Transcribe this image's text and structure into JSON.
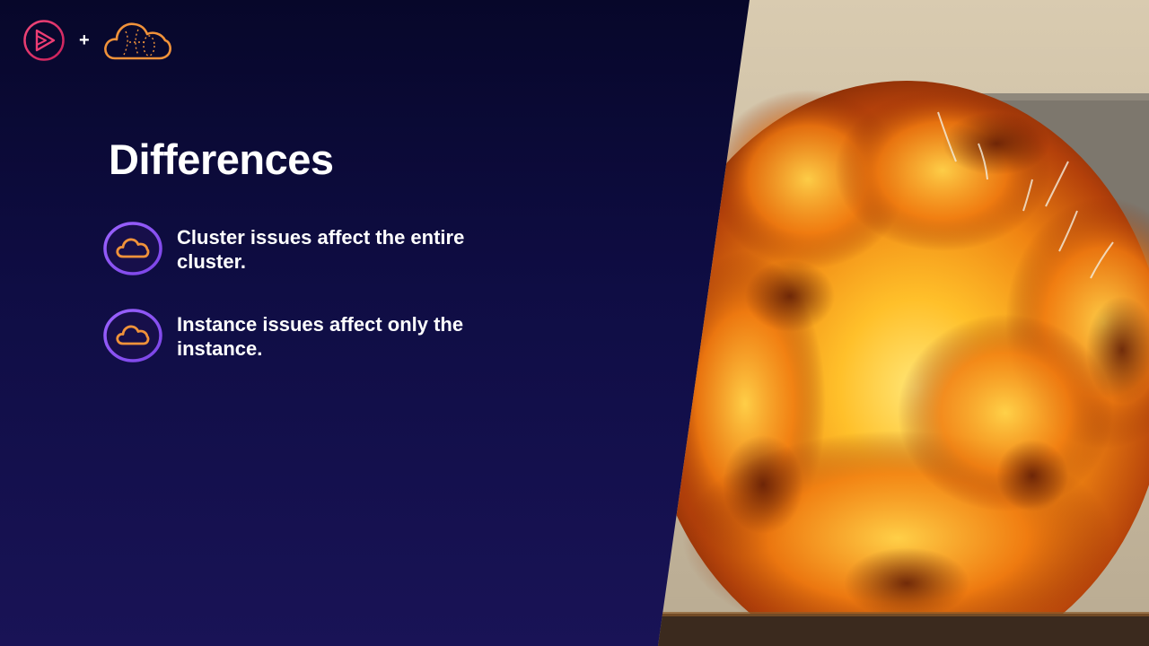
{
  "slide": {
    "title": "Differences",
    "bullets": [
      {
        "text": "Cluster issues affect the entire cluster.",
        "icon": "cloud-icon"
      },
      {
        "text": "Instance issues affect only the instance.",
        "icon": "cloud-icon"
      }
    ]
  },
  "logos": {
    "separator": "+",
    "left_logo": "play-logo",
    "right_logo": "cloud-logo"
  },
  "colors": {
    "accent_purple": "#8a56f0",
    "accent_orange": "#f0923a",
    "logo_pink": "#e8346f"
  }
}
